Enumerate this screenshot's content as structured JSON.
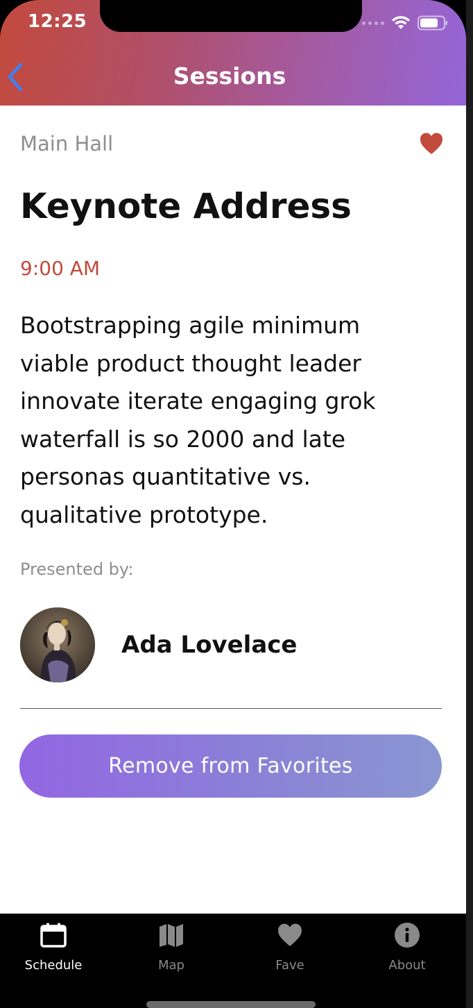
{
  "status_bar": {
    "time": "12:25"
  },
  "header": {
    "title": "Sessions",
    "back_icon": "chevron-left-icon"
  },
  "session": {
    "room": "Main Hall",
    "favorite": true,
    "title": "Keynote Address",
    "time": "9:00 AM",
    "description": "Bootstrapping agile minimum viable product thought leader innovate iterate engaging grok waterfall is so 2000 and late personas quantitative vs. qualitative prototype.",
    "presented_by_label": "Presented by:",
    "speaker": {
      "name": "Ada Lovelace"
    },
    "favorite_button_label": "Remove from Favorites"
  },
  "tabs": [
    {
      "label": "Schedule",
      "icon": "calendar-icon",
      "active": true
    },
    {
      "label": "Map",
      "icon": "map-icon",
      "active": false
    },
    {
      "label": "Fave",
      "icon": "heart-icon",
      "active": false
    },
    {
      "label": "About",
      "icon": "info-icon",
      "active": false
    }
  ],
  "colors": {
    "accent_red": "#c24a3c",
    "gradient_start": "#c24a3c",
    "gradient_end": "#9466d8",
    "button_gradient_start": "#9266e2",
    "button_gradient_end": "#8a97d2",
    "back_arrow": "#3b82f6"
  }
}
